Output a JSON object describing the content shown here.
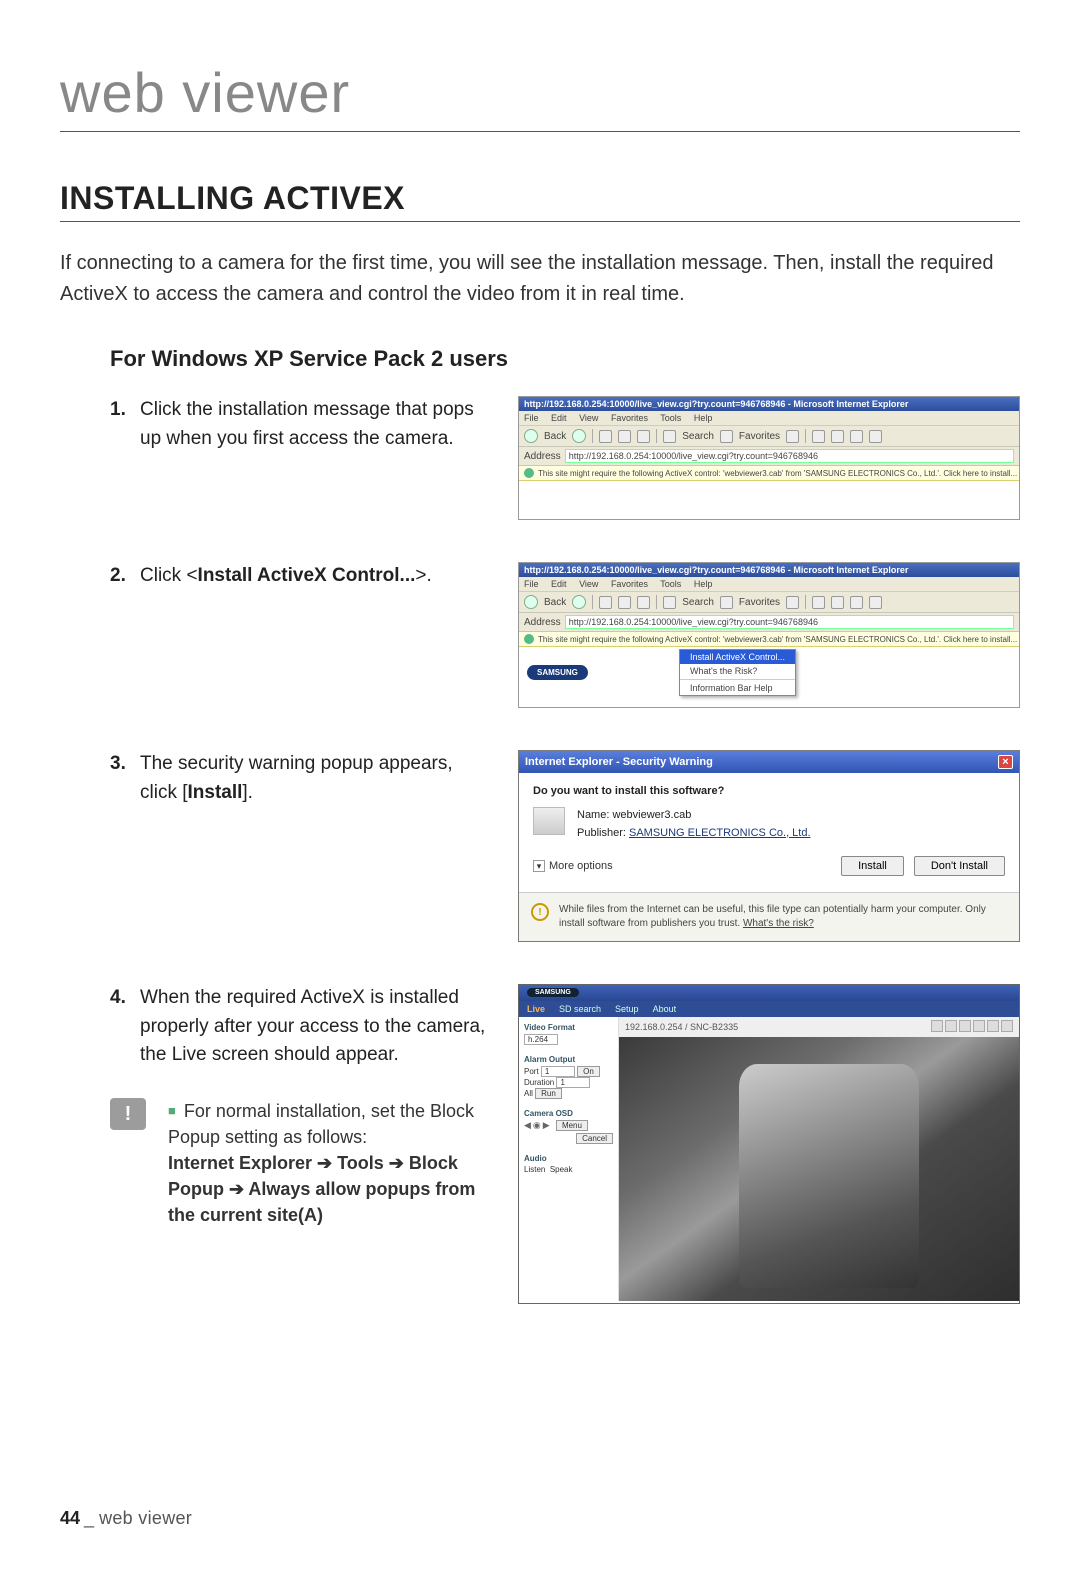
{
  "chapter": "web viewer",
  "section_title": "INSTALLING ACTIVEX",
  "intro": "If connecting to a camera for the first time, you will see the installation message. Then, install the required ActiveX to access the camera and control the video from it in real time.",
  "subsection": "For Windows XP Service Pack 2 users",
  "steps": {
    "s1": {
      "num": "1.",
      "text": "Click the installation message that pops up when you first access the camera."
    },
    "s2": {
      "num": "2.",
      "prefix": "Click <",
      "bold": "Install ActiveX Control...",
      "suffix": ">."
    },
    "s3": {
      "num": "3.",
      "prefix": "The security warning popup appears, click [",
      "bold": "Install",
      "suffix": "]."
    },
    "s4": {
      "num": "4.",
      "text": "When the required ActiveX is installed properly after your access to the camera, the Live screen should appear."
    }
  },
  "note": {
    "lead": "For normal installation, set the Block Popup setting as follows:",
    "path": "Internet Explorer ➔ Tools ➔ Block Popup ➔ Always allow popups from the current site(A)"
  },
  "ie": {
    "title": "http://192.168.0.254:10000/live_view.cgi?try.count=946768946 - Microsoft Internet Explorer",
    "menus": {
      "file": "File",
      "edit": "Edit",
      "view": "View",
      "fav": "Favorites",
      "tools": "Tools",
      "help": "Help"
    },
    "toolbar": {
      "back": "Back",
      "search": "Search",
      "favorites": "Favorites"
    },
    "addr_label": "Address",
    "addr_url": "http://192.168.0.254:10000/live_view.cgi?try.count=946768946",
    "infobar": "This site might require the following ActiveX control: 'webviewer3.cab' from 'SAMSUNG ELECTRONICS Co., Ltd.'. Click here to install...",
    "context": {
      "install": "Install ActiveX Control...",
      "risk": "What's the Risk?",
      "help": "Information Bar Help"
    },
    "samsung": "SAMSUNG"
  },
  "dlg": {
    "title": "Internet Explorer - Security Warning",
    "question": "Do you want to install this software?",
    "name_label": "Name:",
    "name_value": "webviewer3.cab",
    "pub_label": "Publisher:",
    "pub_value": "SAMSUNG ELECTRONICS Co., Ltd.",
    "more": "More options",
    "install_btn": "Install",
    "dont_btn": "Don't Install",
    "warn": "While files from the Internet can be useful, this file type can potentially harm your computer. Only install software from publishers you trust. ",
    "warn_link": "What's the risk?"
  },
  "live": {
    "tabs": {
      "live": "Live",
      "sdsearch": "SD search",
      "setup": "Setup",
      "about": "About"
    },
    "ip_model": "192.168.0.254 / SNC-B2335",
    "side": {
      "vfmt": "Video Format",
      "vfmt_val": "h.264",
      "alarmout": "Alarm Output",
      "port": "Port",
      "port_val": "1",
      "on": "On",
      "duration": "Duration",
      "dur_val": "1",
      "all": "All",
      "run": "Run",
      "camosd": "Camera OSD",
      "menu": "Menu",
      "cancel": "Cancel",
      "audio": "Audio",
      "listen": "Listen",
      "speak": "Speak"
    }
  },
  "footer": {
    "page": "44",
    "sep": "_",
    "label": "web viewer"
  }
}
